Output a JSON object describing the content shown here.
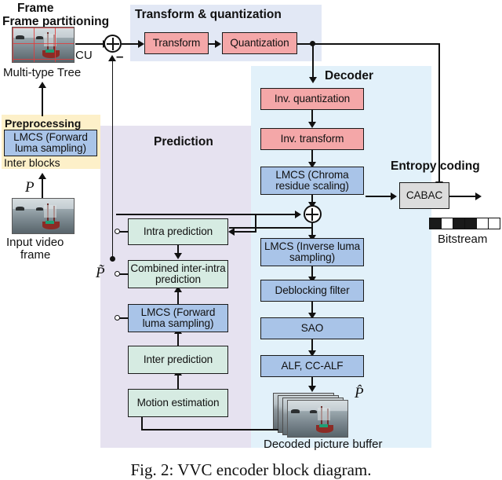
{
  "figure": {
    "caption": "Fig. 2: VVC encoder block diagram.",
    "regions": {
      "transform_quantization": "Transform & quantization",
      "decoder": "Decoder",
      "prediction": "Prediction",
      "preprocessing": "Preprocessing",
      "entropy_coding": "Entropy coding"
    },
    "blocks": {
      "transform": "Transform",
      "quantization": "Quantization",
      "inv_quantization": "Inv. quantization",
      "inv_transform": "Inv. transform",
      "lmcs_chroma": "LMCS (Chroma residue scaling)",
      "lmcs_inverse_luma": "LMCS (Inverse luma sampling)",
      "deblocking": "Deblocking filter",
      "sao": "SAO",
      "alf": "ALF, CC-ALF",
      "intra_prediction": "Intra prediction",
      "combined_inter_intra": "Combined inter-intra prediction",
      "lmcs_forward_luma_pred": "LMCS (Forward luma sampling)",
      "inter_prediction": "Inter prediction",
      "motion_estimation": "Motion estimation",
      "lmcs_forward_luma_prep": "LMCS (Forward luma sampling)",
      "cabac": "CABAC"
    },
    "labels": {
      "frame_partitioning": "Frame partitioning",
      "multi_type_tree": "Multi-type Tree",
      "cu": "CU",
      "minus_sign": "–",
      "inter_blocks": "Inter blocks",
      "input_video_frame": "Input video frame",
      "p_input": "P",
      "p_tilde": "P̃",
      "p_hat": "P̂",
      "decoded_picture_buffer": "Decoded picture buffer",
      "bitstream": "Bitstream"
    },
    "colors": {
      "pink_block": "#f4a7a8",
      "blue_block": "#a9c4e8",
      "mint_block": "#d6ebe2",
      "grey_block": "#dcdcdc",
      "region_transform_bg": "#e2e8f5",
      "region_decoder_bg": "#e2f1fa",
      "region_prediction_bg": "#e6e2f0",
      "region_preprocessing_bg": "#fdf0c9",
      "line": "#111111"
    },
    "bitstream_pattern": [
      1,
      0,
      1,
      1,
      0,
      0
    ]
  }
}
